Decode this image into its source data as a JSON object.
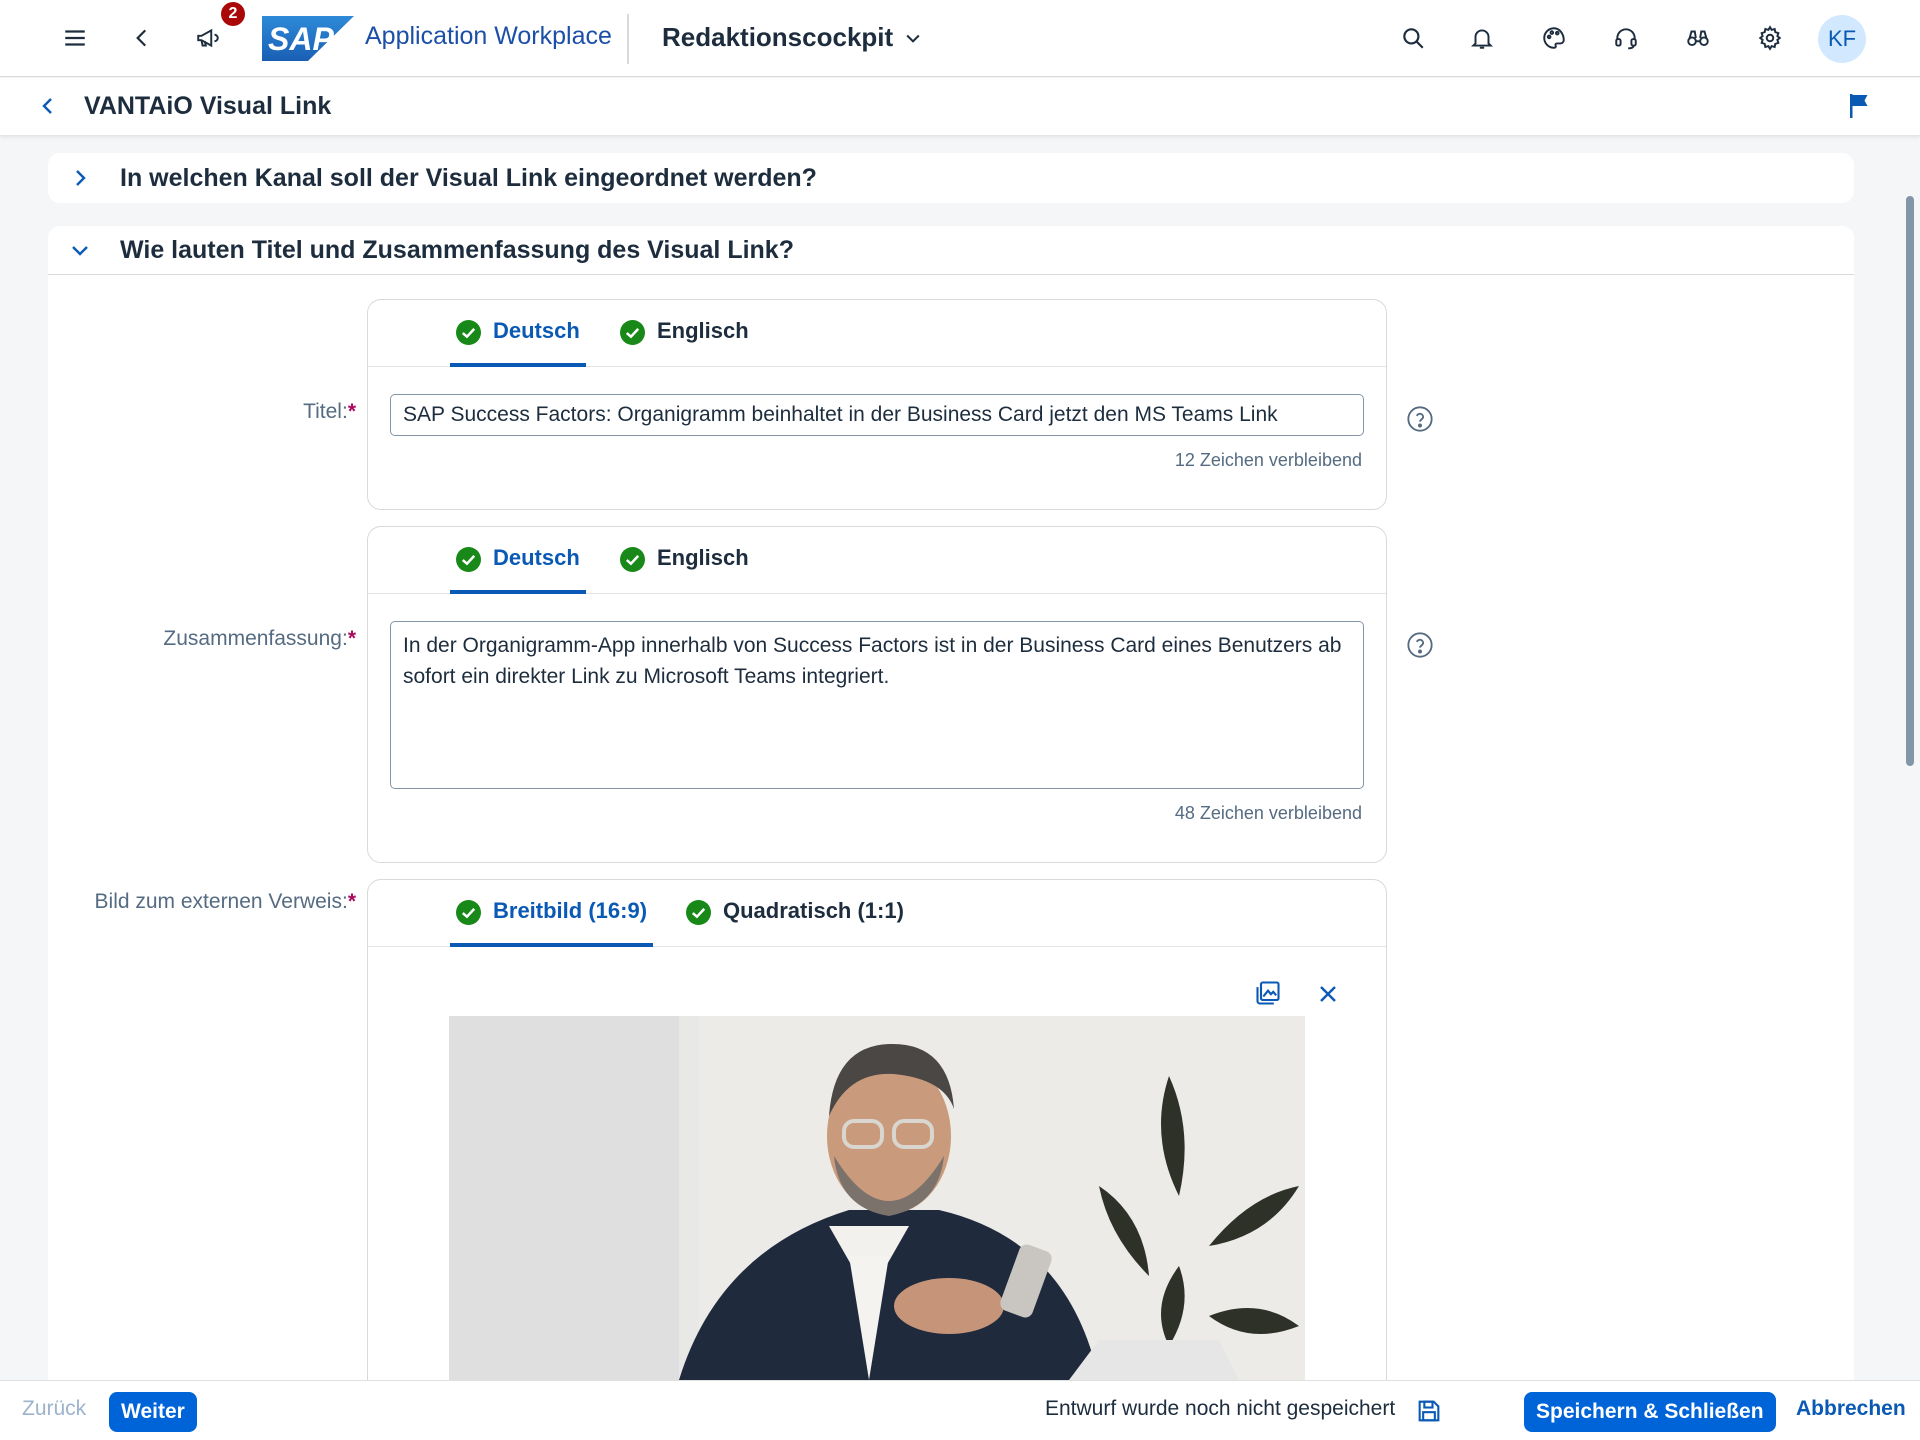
{
  "shell": {
    "notification_count": "2",
    "logo_text": "SAP",
    "app_title": "Application Workplace",
    "space_title": "Redaktionscockpit",
    "avatar_initials": "KF"
  },
  "page": {
    "title": "VANTAiO Visual Link"
  },
  "sections": {
    "channel": {
      "title": "In welchen Kanal soll der Visual Link eingeordnet werden?",
      "expanded": false
    },
    "title_summary": {
      "title": "Wie lauten Titel und Zusammenfassung des Visual Link?",
      "expanded": true
    }
  },
  "title_field": {
    "label": "Titel:",
    "required_mark": "*",
    "tabs": [
      {
        "label": "Deutsch",
        "active": true,
        "status": "ok"
      },
      {
        "label": "Englisch",
        "active": false,
        "status": "ok"
      }
    ],
    "value": "SAP Success Factors: Organigramm beinhaltet in der Business Card jetzt den MS Teams Link",
    "remaining": "12 Zeichen verbleibend"
  },
  "summary_field": {
    "label": "Zusammenfassung:",
    "required_mark": "*",
    "tabs": [
      {
        "label": "Deutsch",
        "active": true,
        "status": "ok"
      },
      {
        "label": "Englisch",
        "active": false,
        "status": "ok"
      }
    ],
    "value": "In der Organigramm-App innerhalb von Success Factors ist in der Business Card eines Benutzers ab sofort ein direkter Link zu Microsoft Teams integriert.",
    "remaining": "48 Zeichen verbleibend"
  },
  "image_field": {
    "label": "Bild zum externen Verweis:",
    "required_mark": "*",
    "tabs": [
      {
        "label": "Breitbild (16:9)",
        "active": true,
        "status": "ok"
      },
      {
        "label": "Quadratisch (1:1)",
        "active": false,
        "status": "ok"
      }
    ]
  },
  "footer": {
    "back_label": "Zurück",
    "next_label": "Weiter",
    "draft_status": "Entwurf wurde noch nicht gespeichert",
    "save_close_label": "Speichern & Schließen",
    "cancel_label": "Abbrechen"
  },
  "colors": {
    "accent": "#0064d9",
    "link": "#0a5ab5",
    "success": "#188918",
    "required": "#aa0a5e",
    "badge": "#aa0808"
  }
}
